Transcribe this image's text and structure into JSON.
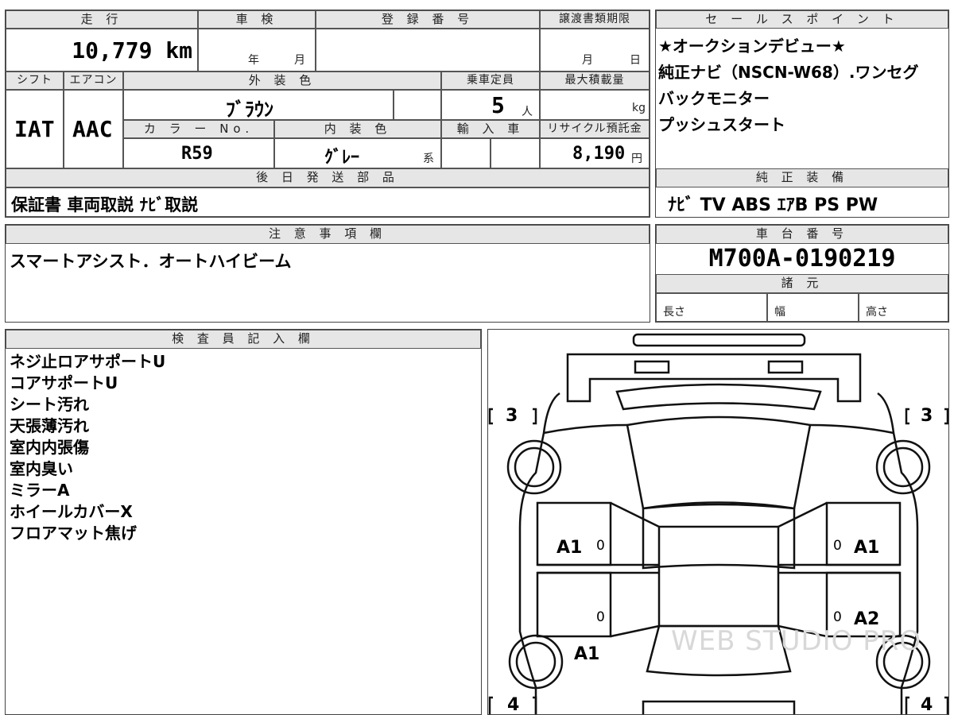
{
  "top_left": {
    "mileage_label": "走 行",
    "mileage_value": "10,779 km",
    "inspection_label": "車 検",
    "inspection_year_unit": "年",
    "inspection_month_unit": "月",
    "registration_label": "登 録 番 号",
    "transfer_label": "譲渡書類期限",
    "transfer_month_unit": "月",
    "transfer_day_unit": "日",
    "shift_label": "シフト",
    "shift_value": "IAT",
    "ac_label": "エアコン",
    "ac_value": "AAC",
    "exterior_label": "外 装 色",
    "exterior_value": "ﾌﾞﾗｳﾝ",
    "capacity_label": "乗車定員",
    "capacity_value": "5",
    "capacity_unit": "人",
    "max_load_label": "最大積載量",
    "max_load_unit": "kg",
    "color_no_label": "カ ラ ー No.",
    "color_no_value": "R59",
    "interior_label": "内 装 色",
    "interior_value": "ｸﾞﾚｰ",
    "interior_suffix": "系",
    "import_label": "輸 入 車",
    "recycle_label": "リサイクル預託金",
    "recycle_value": "8,190",
    "recycle_unit": "円",
    "later_parts_label": "後 日 発 送 部 品",
    "later_parts_value": "保証書 車両取説 ﾅﾋﾞ取説"
  },
  "sales_points": {
    "label": "セ ー ル ス ポ イ ン ト",
    "lines": [
      "★オークションデビュー★",
      "純正ナビ（NSCN-W68）.ワンセグ",
      "バックモニター",
      "プッシュスタート"
    ]
  },
  "equipment": {
    "label": "純 正 装 備",
    "value": "ﾅﾋﾞ TV ABS ｴｱB PS PW"
  },
  "notes": {
    "label": "注 意 事 項 欄",
    "value": "スマートアシスト．オートハイビーム"
  },
  "chassis": {
    "label": "車 台 番 号",
    "value": "M700A-0190219",
    "spec_label": "諸 元",
    "length_label": "長さ",
    "width_label": "幅",
    "height_label": "高さ"
  },
  "inspector": {
    "label": "検 査 員 記 入 欄",
    "lines": [
      "ネジ止ロアサポートU",
      "コアサポートU",
      "シート汚れ",
      "天張薄汚れ",
      "室内内張傷",
      "室内臭い",
      "ミラーA",
      "ホイールカバーX",
      "フロアマット焦げ"
    ]
  },
  "diagram": {
    "tire_front_left": "3",
    "tire_front_right": "3",
    "tire_rear_left": "4",
    "tire_rear_right": "4",
    "mark_left_front_door": "A1",
    "mark_right_front_door": "A1",
    "mark_right_rear_door": "A2",
    "mark_left_rear_fender": "A1",
    "zero_1": "0",
    "zero_2": "0",
    "zero_3": "0",
    "zero_4": "0",
    "watermark": "WEB STUDIO PRO"
  }
}
